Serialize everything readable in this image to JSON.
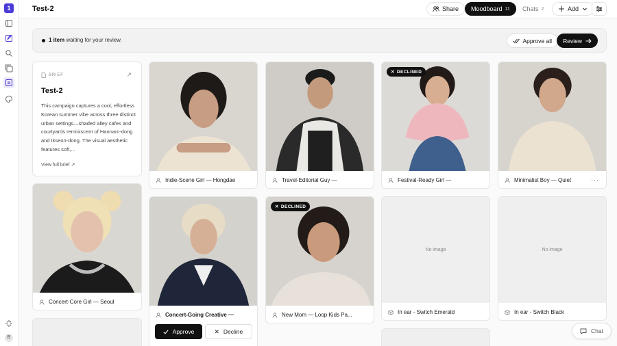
{
  "app": {
    "logo": "1",
    "avatar_initial": "B"
  },
  "header": {
    "title": "Test-2",
    "share_label": "Share",
    "moodboard_label": "Moodboard",
    "moodboard_count": "11",
    "chats_label": "Chats",
    "chats_count": "2",
    "add_label": "Add"
  },
  "notice": {
    "count_text": "1 item",
    "message": "waiting for your review.",
    "approve_all_label": "Approve all",
    "review_label": "Review"
  },
  "brief": {
    "label": "BRIEF",
    "title": "Test-2",
    "description": "This campaign captures a cool, effortless Korean summer vibe across three distinct urban settings—shaded alley cafes and courtyards reminiscent of Hannam-dong and Ikseon-dong. The visual aesthetic features soft,...",
    "view_full": "View full brief"
  },
  "cards": [
    {
      "name": "Indie-Scene Girl — Hongdae"
    },
    {
      "name": "Travel-Editorial Guy —"
    },
    {
      "name": "Festival-Ready Girl —",
      "badge": "DECLINED"
    },
    {
      "name": "Minimalist Boy — Quiet",
      "more": "···"
    },
    {
      "name": "Concert-Core Girl — Seoul"
    },
    {
      "name": "Concert-Going Creative —"
    },
    {
      "name": "New Mom — Loop Kids Pa...",
      "badge": "DECLINED"
    },
    {
      "name": "In ear - Switch Emerald",
      "noimage": "No image"
    },
    {
      "name": "In ear - Switch Black",
      "noimage": "No image"
    }
  ],
  "review_actions": {
    "approve_label": "Approve",
    "decline_label": "Decline"
  },
  "chat_label": "Chat",
  "colors": {
    "accent": "#4b3bd6",
    "dark": "#111111"
  }
}
